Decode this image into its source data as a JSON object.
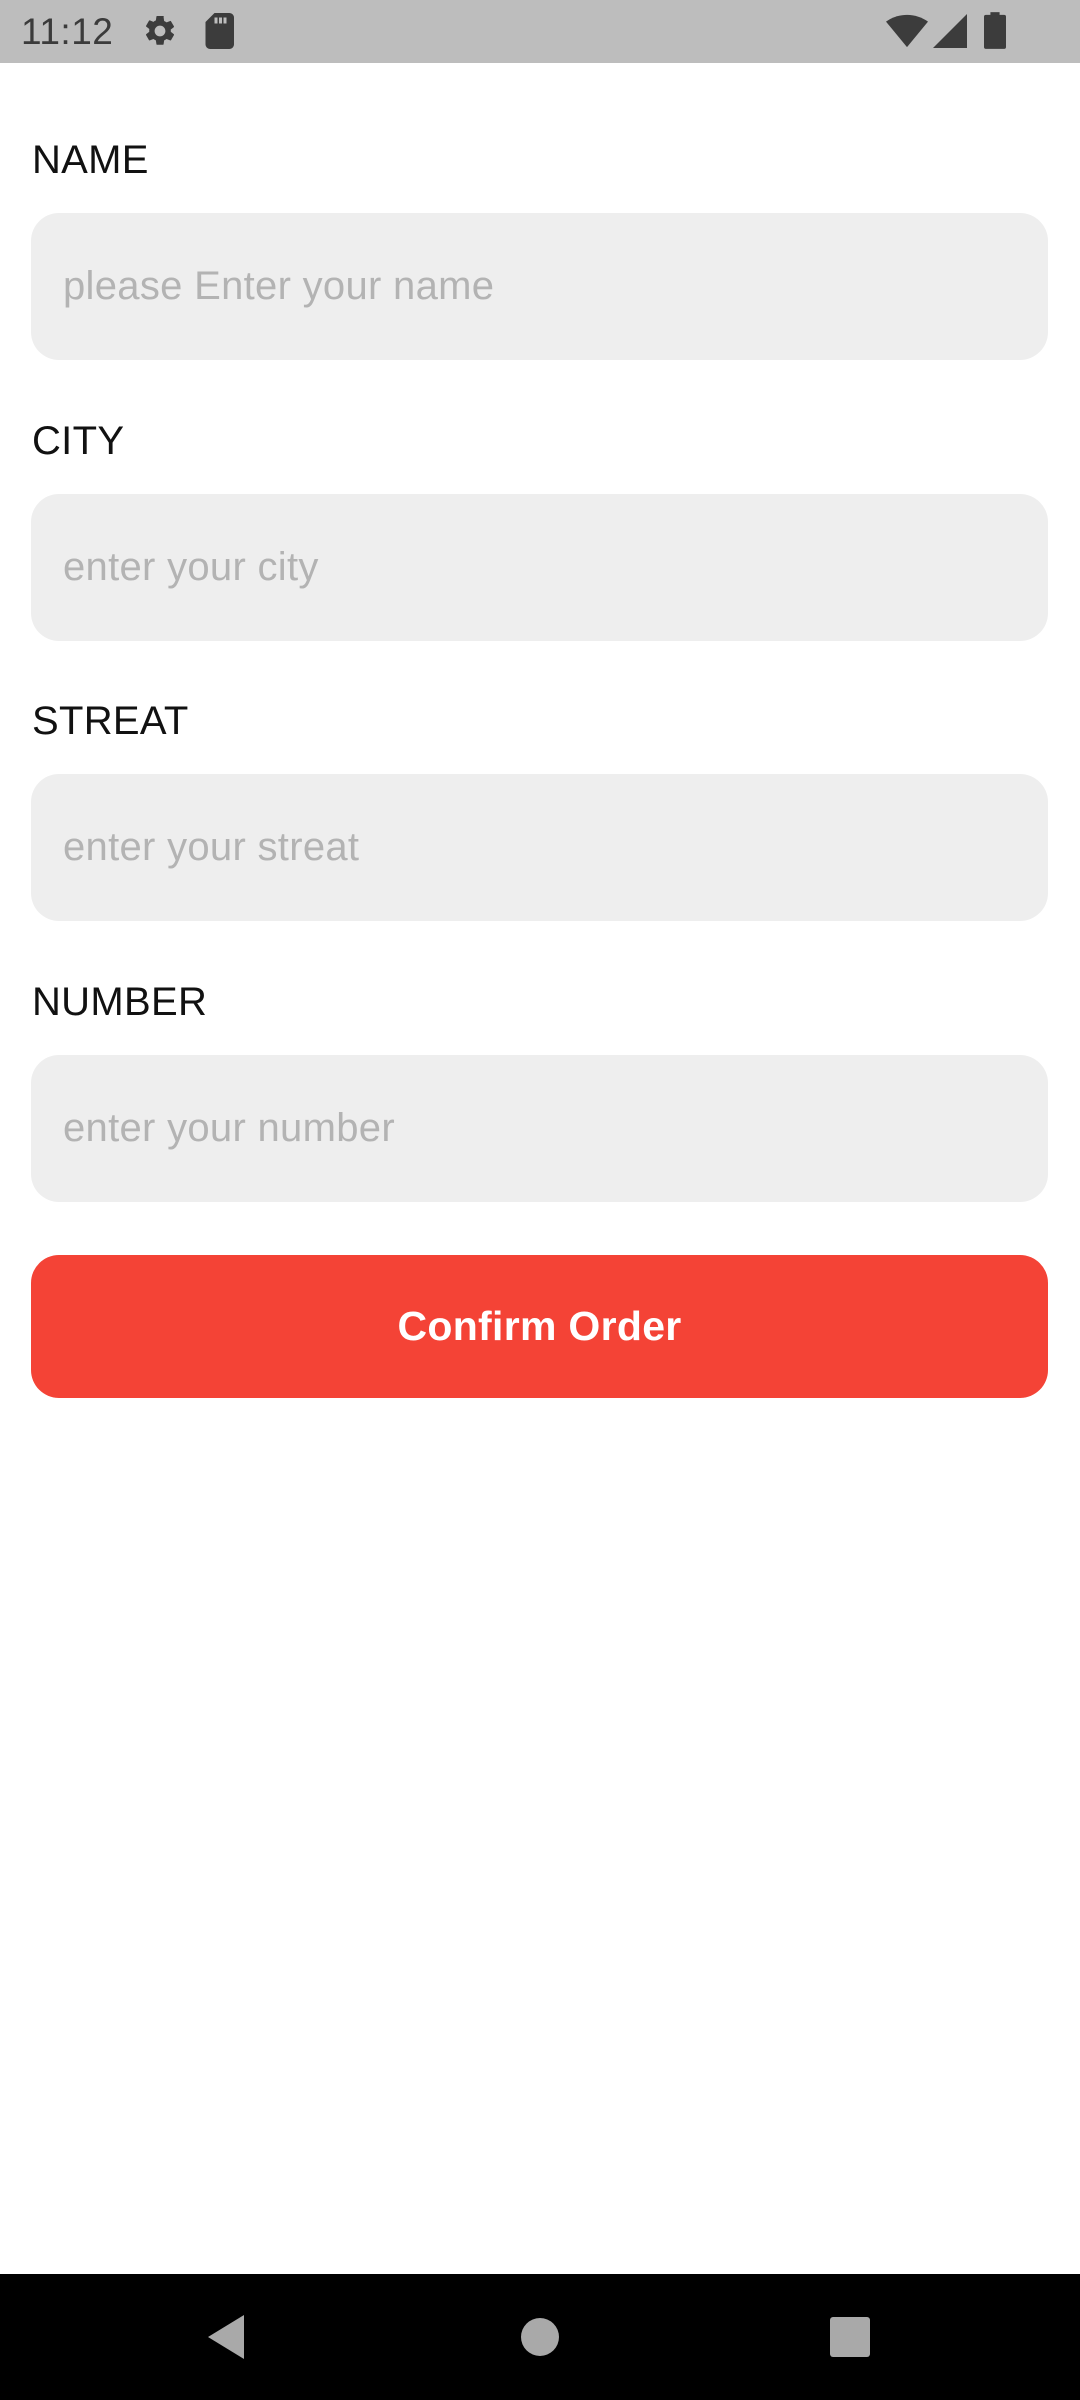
{
  "status_bar": {
    "time": "11:12",
    "icons": [
      "gear-icon",
      "sd-card-icon",
      "wifi-icon",
      "cell-signal-icon",
      "battery-icon"
    ]
  },
  "form": {
    "fields": [
      {
        "label": "NAME",
        "placeholder": "please Enter your name",
        "value": ""
      },
      {
        "label": "CITY",
        "placeholder": "enter your city",
        "value": ""
      },
      {
        "label": "STREAT",
        "placeholder": "enter your streat",
        "value": ""
      },
      {
        "label": "NUMBER",
        "placeholder": "enter your number",
        "value": ""
      }
    ],
    "confirm_label": "Confirm Order"
  },
  "nav_bar": {
    "icons": [
      "back-icon",
      "home-icon",
      "recents-icon"
    ]
  },
  "colors": {
    "accent": "#f44336",
    "input_background": "#eeeeee",
    "status_bar": "#bdbdbd",
    "nav_bar": "#000000"
  }
}
